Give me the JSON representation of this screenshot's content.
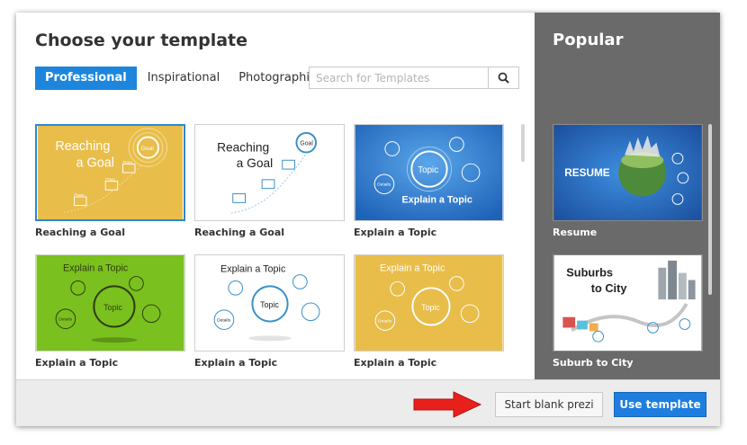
{
  "dialog": {
    "title": "Choose your template",
    "tabs": [
      {
        "label": "Professional"
      },
      {
        "label": "Inspirational"
      },
      {
        "label": "Photographic"
      }
    ],
    "search": {
      "placeholder": "Search for Templates"
    },
    "templates": [
      {
        "label": "Reaching a Goal",
        "thumb_title": "Reaching a Goal",
        "line1": "Reaching",
        "line2": "a Goal",
        "goal": "Goal",
        "phase": "Phase",
        "nums": [
          "1",
          "2",
          "3"
        ]
      },
      {
        "label": "Reaching a Goal",
        "line1": "Reaching",
        "line2": "a Goal",
        "goal": "Goal",
        "phase": "Phase",
        "nums": [
          "1",
          "2",
          "3"
        ]
      },
      {
        "label": "Explain a Topic",
        "topic": "Topic",
        "details": "Details",
        "heading": "Explain a Topic"
      },
      {
        "label": "Explain a Topic",
        "heading": "Explain a Topic",
        "topic": "Topic",
        "details": "Details"
      },
      {
        "label": "Explain a Topic",
        "heading": "Explain a Topic",
        "topic": "Topic",
        "details": "Details"
      },
      {
        "label": "Explain a Topic",
        "heading": "Explain a Topic",
        "topic": "Topic",
        "details": "Details"
      }
    ]
  },
  "popular": {
    "title": "Popular",
    "items": [
      {
        "label": "Resume",
        "thumb_text": "RESUME"
      },
      {
        "label": "Suburb to City",
        "line1": "Suburbs",
        "line2": "to City"
      }
    ]
  },
  "footer": {
    "blank_label": "Start blank prezi",
    "use_label": "Use template"
  },
  "colors": {
    "accent": "#1d86dc",
    "gold": "#e8bd4a",
    "green": "#7ac01e",
    "blue": "#2f7cd3",
    "popular_bg": "#6a6a6a",
    "arrow": "#e8201b"
  }
}
